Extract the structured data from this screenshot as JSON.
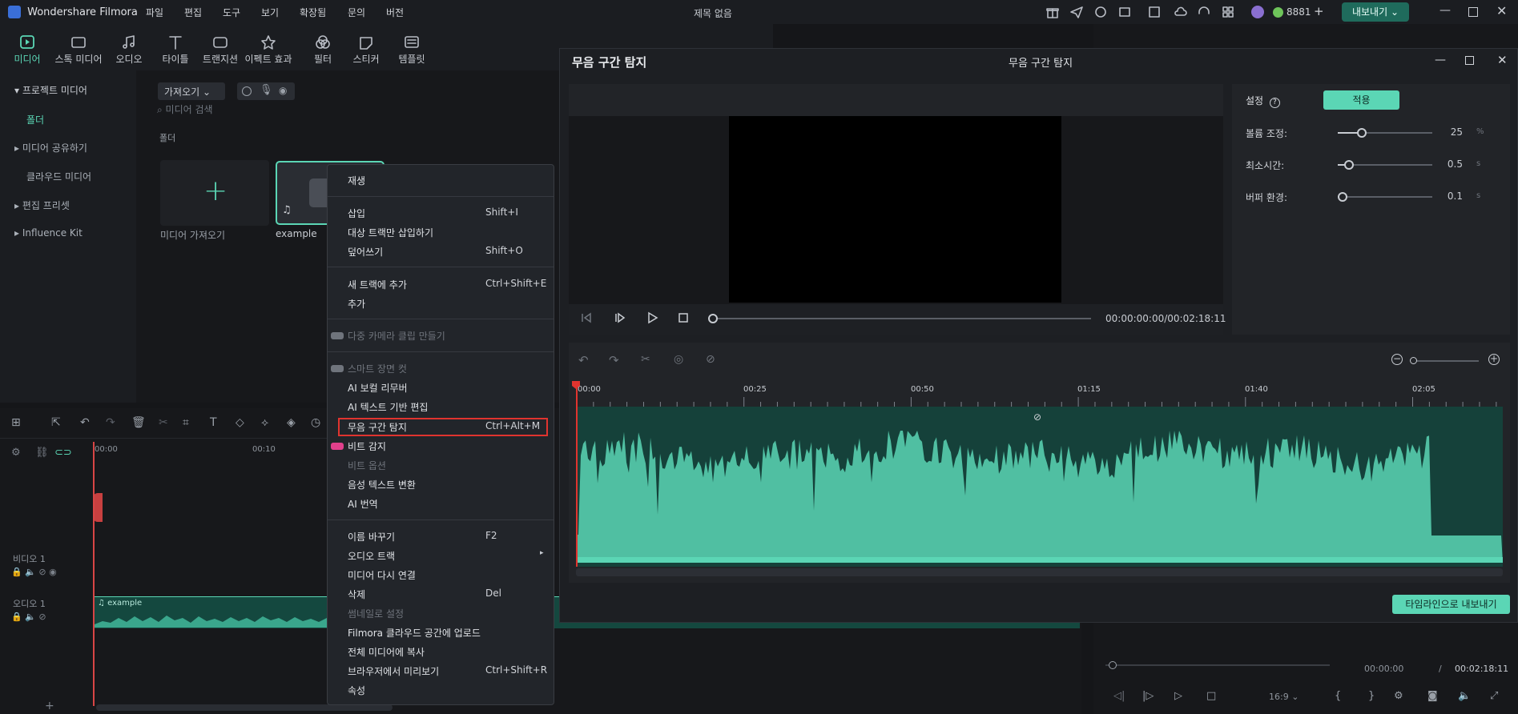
{
  "app": {
    "name": "Wondershare Filmora",
    "menu": [
      "파일",
      "편집",
      "도구",
      "보기",
      "확장됨",
      "문의",
      "버전"
    ],
    "doc_title": "제목 없음",
    "credits": "8881",
    "export_label": "내보내기"
  },
  "toolbar": {
    "tools": [
      "미디어",
      "스톡 미디어",
      "오디오",
      "타이틀",
      "트랜지션",
      "이펙트 효과",
      "필터",
      "스티커",
      "템플릿"
    ]
  },
  "sidebar": {
    "items": [
      "프로젝트 미디어",
      "폴더",
      "미디어 공유하기",
      "클라우드 미디어",
      "편집 프리셋",
      "Influence Kit"
    ]
  },
  "media": {
    "import_dropdown": "가져오기",
    "search_placeholder": "미디어 검색",
    "folder_label": "폴더",
    "import_card_label": "미디어 가져오기",
    "clip_label": "example"
  },
  "timeline": {
    "ticks": [
      "00:00",
      "00:10"
    ],
    "video_track": "비디오 1",
    "audio_track": "오디오 1",
    "clip_label": "example"
  },
  "context_menu": {
    "items": [
      {
        "label": "재생",
        "shortcut": ""
      },
      {
        "label": "삽입",
        "shortcut": "Shift+I"
      },
      {
        "label": "대상 트랙만 삽입하기",
        "shortcut": ""
      },
      {
        "label": "덮어쓰기",
        "shortcut": "Shift+O"
      },
      {
        "label": "새 트랙에 추가",
        "shortcut": "Ctrl+Shift+E"
      },
      {
        "label": "추가",
        "shortcut": ""
      },
      {
        "label": "다중 카메라 클립 만들기",
        "shortcut": ""
      },
      {
        "label": "스마트 장면 컷",
        "shortcut": ""
      },
      {
        "label": "AI 보컬 리무버",
        "shortcut": ""
      },
      {
        "label": "AI 텍스트 기반 편집",
        "shortcut": ""
      },
      {
        "label": "무음 구간 탐지",
        "shortcut": "Ctrl+Alt+M"
      },
      {
        "label": "비트 감지",
        "shortcut": ""
      },
      {
        "label": "비트 옵션",
        "shortcut": ""
      },
      {
        "label": "음성 텍스트 변환",
        "shortcut": ""
      },
      {
        "label": "AI 번역",
        "shortcut": ""
      },
      {
        "label": "이름 바꾸기",
        "shortcut": "F2"
      },
      {
        "label": "오디오 트랙",
        "shortcut": ""
      },
      {
        "label": "미디어 다시 연결",
        "shortcut": ""
      },
      {
        "label": "삭제",
        "shortcut": "Del"
      },
      {
        "label": "썸네일로 설정",
        "shortcut": ""
      },
      {
        "label": "Filmora 클라우드 공간에 업로드",
        "shortcut": ""
      },
      {
        "label": "전체 미디어에 복사",
        "shortcut": ""
      },
      {
        "label": "브라우저에서 미리보기",
        "shortcut": "Ctrl+Shift+R"
      },
      {
        "label": "속성",
        "shortcut": ""
      }
    ]
  },
  "dialog": {
    "title": "무음 구간 탐지",
    "timecode": "00:00:00:00/00:02:18:11",
    "settings_label": "설정",
    "apply_label": "적용",
    "volume_label": "볼륨 조정:",
    "volume_value": "25",
    "volume_unit": "%",
    "volume_level": 0.25,
    "min_time_label": "최소시간:",
    "min_time_value": "0.5",
    "min_time_unit": "s",
    "min_time_level": 0.12,
    "buffer_label": "버퍼 환경:",
    "buffer_value": "0.1",
    "buffer_unit": "s",
    "buffer_level": 0.05,
    "ruler_ticks": [
      "00:00",
      "00:25",
      "00:50",
      "01:15",
      "01:40",
      "02:05"
    ],
    "export_timeline_label": "타임라인으로 내보내기"
  },
  "right_panel": {
    "time_current": "00:00:00",
    "time_total": "00:02:18:11",
    "time_separator": "/",
    "ratio": "16:9"
  },
  "colors": {
    "accent": "#5bd6b5",
    "highlight_red": "#e0342f"
  }
}
